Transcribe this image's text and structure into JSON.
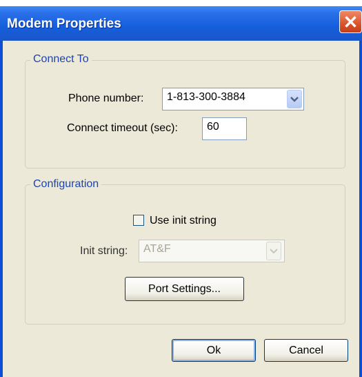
{
  "window": {
    "title": "Modem Properties",
    "close_icon": "close-icon"
  },
  "connect_group": {
    "legend": "Connect To",
    "phone_label": "Phone number:",
    "phone_value": "1-813-300-3884",
    "timeout_label": "Connect timeout (sec):",
    "timeout_value": "60"
  },
  "config_group": {
    "legend": "Configuration",
    "use_init_label": "Use init string",
    "use_init_checked": false,
    "init_label": "Init string:",
    "init_value": "AT&F",
    "port_settings_label": "Port Settings..."
  },
  "buttons": {
    "ok": "Ok",
    "cancel": "Cancel"
  },
  "colors": {
    "title_bar": "#155fdc",
    "dialog_bg": "#ece9d8",
    "legend_text": "#1a44b3",
    "close_bg": "#d9542c"
  }
}
